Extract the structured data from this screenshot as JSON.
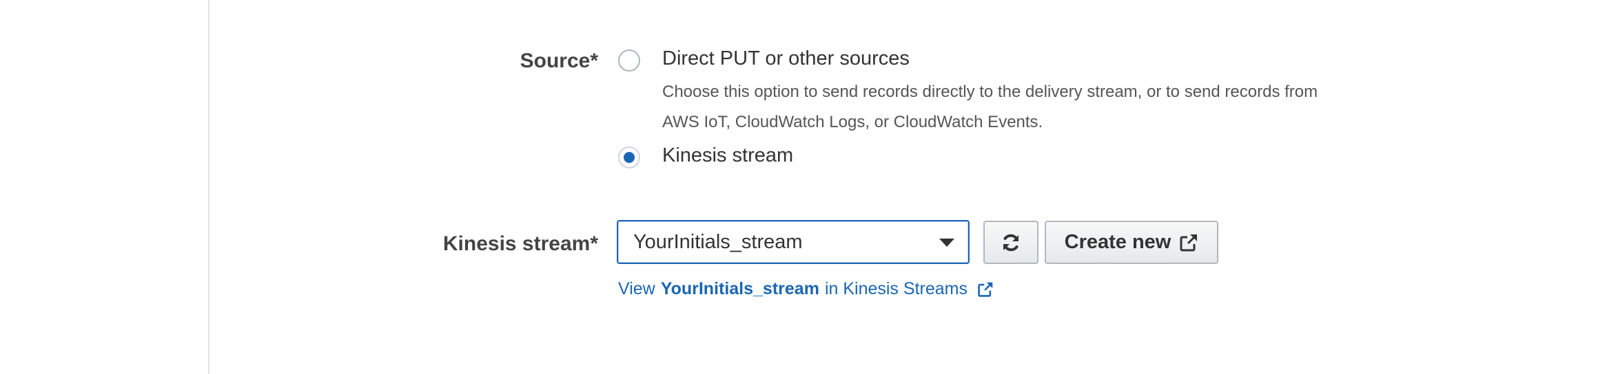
{
  "form": {
    "source_label": "Source*",
    "source_options": [
      {
        "label": "Direct PUT or other sources",
        "description": "Choose this option to send records directly to the delivery stream, or to send records from AWS IoT, CloudWatch Logs, or CloudWatch Events.",
        "selected": false
      },
      {
        "label": "Kinesis stream",
        "selected": true
      }
    ],
    "kinesis_stream_label": "Kinesis stream*",
    "kinesis_stream_value": "YourInitials_stream",
    "create_new_label": "Create new",
    "view_link": {
      "prefix": "View",
      "stream_name": "YourInitials_stream",
      "suffix": "in Kinesis Streams"
    }
  },
  "icons": {
    "refresh": "refresh-icon",
    "external": "external-link-icon",
    "caret": "caret-down-icon"
  },
  "colors": {
    "accent": "#1a66b3",
    "text": "#333333",
    "border": "#b0b8bd"
  }
}
